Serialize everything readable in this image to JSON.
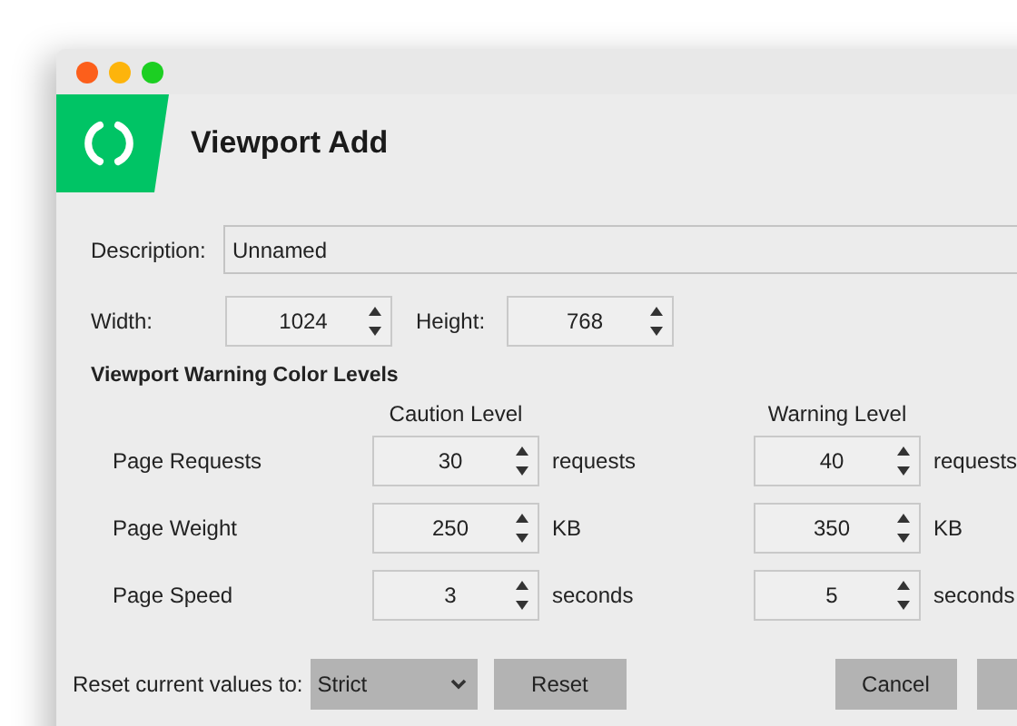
{
  "window": {
    "title": "Viewport Add"
  },
  "description": {
    "label": "Description:",
    "value": "Unnamed"
  },
  "size": [
    {
      "label": "Width:",
      "value": "1024"
    },
    {
      "label": "Height:",
      "value": "768"
    }
  ],
  "levels": {
    "title": "Viewport Warning Color Levels",
    "columns": [
      "Caution Level",
      "Warning Level"
    ],
    "rows": [
      {
        "label": "Page Requests",
        "caution": "30",
        "caution_unit": "requests",
        "warning": "40",
        "warning_unit": "requests"
      },
      {
        "label": "Page Weight",
        "caution": "250",
        "caution_unit": "KB",
        "warning": "350",
        "warning_unit": "KB"
      },
      {
        "label": "Page Speed",
        "caution": "3",
        "caution_unit": "seconds",
        "warning": "5",
        "warning_unit": "seconds"
      }
    ]
  },
  "footer": {
    "reset_label": "Reset current values to:",
    "preset": "Strict",
    "buttons": [
      {
        "kind": "reset",
        "label": "Reset"
      },
      {
        "kind": "cancel",
        "label": "Cancel"
      },
      {
        "kind": "confirm"
      }
    ]
  }
}
